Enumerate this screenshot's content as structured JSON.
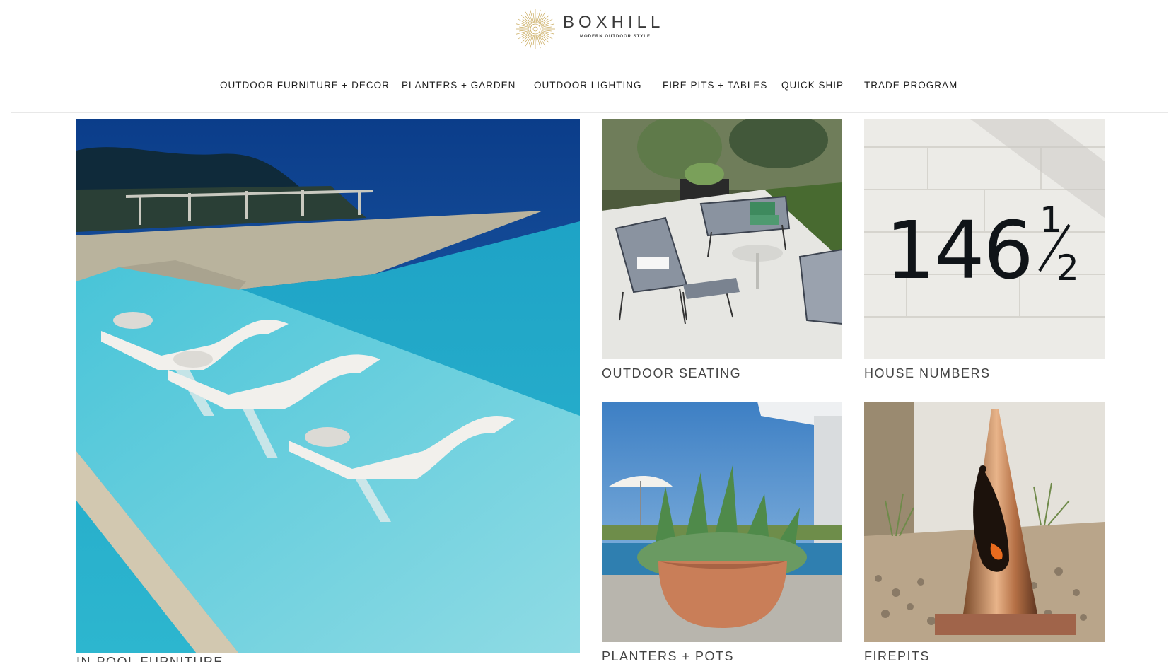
{
  "brand": {
    "name": "BOXHILL",
    "tagline": "MODERN OUTDOOR STYLE",
    "logo_color": "#c8a85a"
  },
  "nav": {
    "items": [
      {
        "label": "OUTDOOR FURNITURE + DECOR"
      },
      {
        "label": "PLANTERS + GARDEN"
      },
      {
        "label": "OUTDOOR LIGHTING"
      },
      {
        "label": "FIRE PITS + TABLES"
      },
      {
        "label": "QUICK SHIP"
      },
      {
        "label": "TRADE PROGRAM"
      }
    ]
  },
  "categories": [
    {
      "label": "IN-POOL FURNITURE",
      "image": "in-pool lounge chairs"
    },
    {
      "label": "OUTDOOR SEATING",
      "image": "outdoor lounge set"
    },
    {
      "label": "HOUSE NUMBERS",
      "image": "house number 146 1/2",
      "number_text": "146",
      "fraction_num": "1",
      "fraction_den": "2"
    },
    {
      "label": "PLANTERS + POTS",
      "image": "terracotta bowl planter"
    },
    {
      "label": "FIREPITS",
      "image": "copper cone firepit"
    }
  ]
}
